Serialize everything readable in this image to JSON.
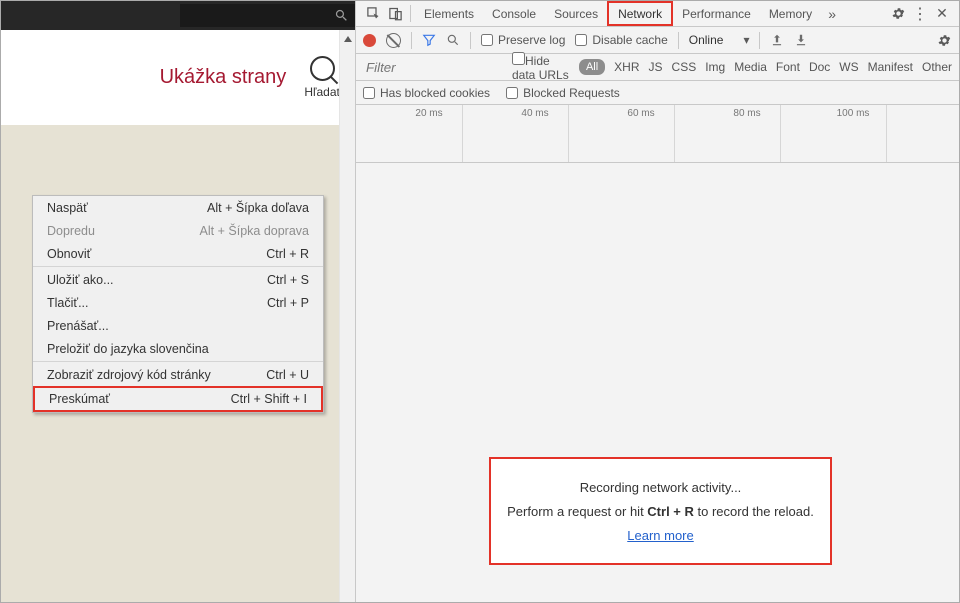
{
  "page": {
    "title": "Ukážka strany",
    "search_label": "Hľadať"
  },
  "context_menu": {
    "back": {
      "label": "Naspäť",
      "shortcut": "Alt + Šípka doľava"
    },
    "forward": {
      "label": "Dopredu",
      "shortcut": "Alt + Šípka doprava"
    },
    "reload": {
      "label": "Obnoviť",
      "shortcut": "Ctrl + R"
    },
    "save_as": {
      "label": "Uložiť ako...",
      "shortcut": "Ctrl + S"
    },
    "print": {
      "label": "Tlačiť...",
      "shortcut": "Ctrl + P"
    },
    "cast": {
      "label": "Prenášať..."
    },
    "translate": {
      "label": "Preložiť do jazyka slovenčina"
    },
    "view_source": {
      "label": "Zobraziť zdrojový kód stránky",
      "shortcut": "Ctrl + U"
    },
    "inspect": {
      "label": "Preskúmať",
      "shortcut": "Ctrl + Shift + I"
    }
  },
  "devtools": {
    "tabs": {
      "elements": "Elements",
      "console": "Console",
      "sources": "Sources",
      "network": "Network",
      "performance": "Performance",
      "memory": "Memory"
    },
    "toolbar": {
      "preserve_log": "Preserve log",
      "disable_cache": "Disable cache",
      "throttle": "Online"
    },
    "filter": {
      "placeholder": "Filter",
      "hide_data_urls": "Hide data URLs",
      "all": "All",
      "types": [
        "XHR",
        "JS",
        "CSS",
        "Img",
        "Media",
        "Font",
        "Doc",
        "WS",
        "Manifest",
        "Other"
      ]
    },
    "filter2": {
      "blocked_cookies": "Has blocked cookies",
      "blocked_requests": "Blocked Requests"
    },
    "timeline": {
      "ticks": [
        "20 ms",
        "40 ms",
        "60 ms",
        "80 ms",
        "100 ms"
      ]
    },
    "recording": {
      "line1": "Recording network activity...",
      "line2_a": "Perform a request or hit ",
      "line2_b": "Ctrl + R",
      "line2_c": " to record the reload.",
      "learn_more": "Learn more"
    }
  }
}
